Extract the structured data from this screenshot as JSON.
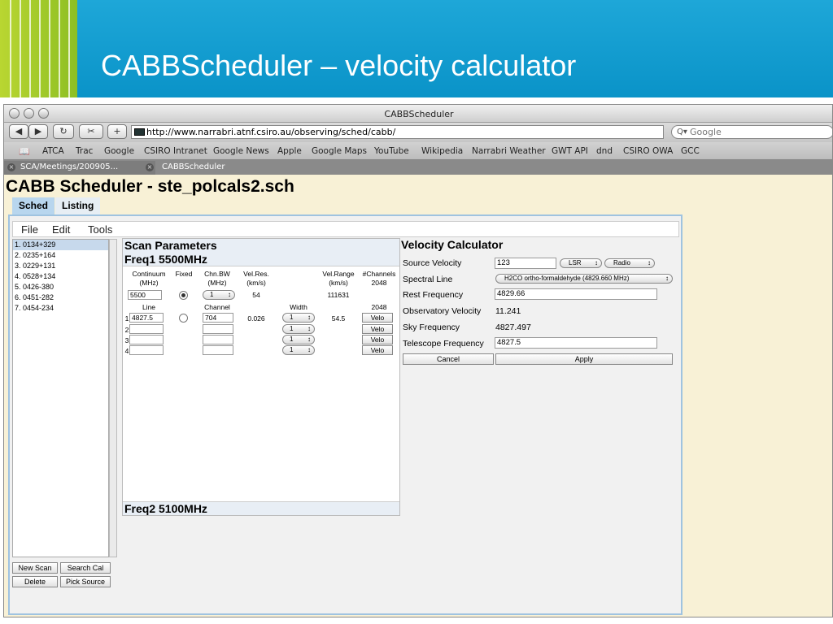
{
  "slide": {
    "title": "CABBScheduler – velocity calculator"
  },
  "browser": {
    "window_title": "CABBScheduler",
    "url": "http://www.narrabri.atnf.csiro.au/observing/sched/cabb/",
    "search_placeholder": "Google",
    "bookmarks": [
      "ATCA",
      "Trac",
      "Google",
      "CSIRO Intranet",
      "Google News",
      "Apple",
      "Google Maps",
      "YouTube",
      "Wikipedia",
      "Narrabri Weather",
      "GWT API",
      "dnd",
      "CSIRO OWA",
      "GCC"
    ],
    "tabs": [
      "SCA/Meetings/200905...",
      "CABBScheduler"
    ]
  },
  "page": {
    "heading": "CABB Scheduler - ste_polcals2.sch",
    "tabs": {
      "sched": "Sched",
      "listing": "Listing"
    },
    "menu": {
      "file": "File",
      "edit": "Edit",
      "tools": "Tools"
    },
    "sources": [
      "1. 0134+329",
      "2. 0235+164",
      "3. 0229+131",
      "4. 0528+134",
      "5. 0426-380",
      "6. 0451-282",
      "7. 0454-234"
    ],
    "buttons": {
      "new_scan": "New Scan",
      "search_cal": "Search Cal",
      "delete": "Delete",
      "pick_source": "Pick Source"
    }
  },
  "scan": {
    "title": "Scan Parameters",
    "freq1": "Freq1 5500MHz",
    "freq2": "Freq2 5100MHz",
    "headers": {
      "continuum": "Continuum",
      "mhz": "(MHz)",
      "fixed": "Fixed",
      "chnbw": "Chn.BW",
      "chnbw_unit": "(MHz)",
      "velres": "Vel.Res.",
      "kms": "(km/s)",
      "velrange": "Vel.Range",
      "velrange_unit": "(km/s)",
      "nchan": "#Channels",
      "nchan_val": "2048"
    },
    "continuum_value": "5500",
    "chnbw_value": "1",
    "velres_value": "54",
    "velrange_value": "111631",
    "line_headers": {
      "line": "Line",
      "channel": "Channel",
      "width": "Width",
      "nchan": "2048"
    },
    "lines": [
      {
        "num": "1",
        "line": "4827.5",
        "channel": "704",
        "velres": "0.026",
        "width": "1",
        "range": "54.5",
        "velo": "Velo"
      },
      {
        "num": "2",
        "line": "",
        "channel": "",
        "width": "1",
        "velo": "Velo"
      },
      {
        "num": "3",
        "line": "",
        "channel": "",
        "width": "1",
        "velo": "Velo"
      },
      {
        "num": "4",
        "line": "",
        "channel": "",
        "width": "1",
        "velo": "Velo"
      }
    ]
  },
  "calc": {
    "title": "Velocity Calculator",
    "source_velocity_label": "Source Velocity",
    "source_velocity": "123",
    "frame": "LSR",
    "convention": "Radio",
    "spectral_line_label": "Spectral Line",
    "spectral_line": "H2CO ortho-formaldehyde (4829.660 MHz)",
    "rest_freq_label": "Rest Frequency",
    "rest_freq": "4829.66",
    "obs_vel_label": "Observatory Velocity",
    "obs_vel": "11.241",
    "sky_freq_label": "Sky Frequency",
    "sky_freq": "4827.497",
    "tel_freq_label": "Telescope Frequency",
    "tel_freq": "4827.5",
    "cancel": "Cancel",
    "apply": "Apply"
  }
}
